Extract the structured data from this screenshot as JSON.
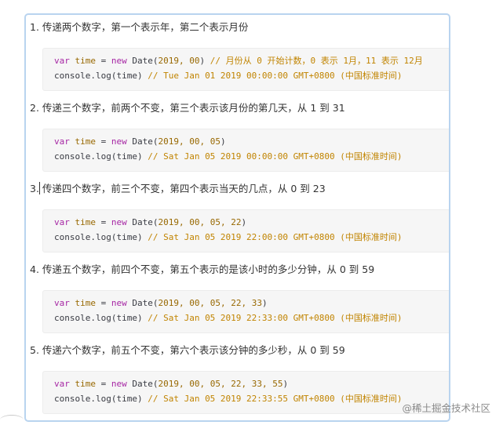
{
  "sections": [
    {
      "heading": "1. 传递两个数字，第一个表示年，第二个表示月份",
      "line1": {
        "kw": "var",
        "var": "time",
        "op": " = ",
        "new": "new",
        "call": " Date(",
        "args": "2019, 00",
        "close": ")",
        "comment": " // 月份从 0 开始计数，0 表示 1月，11 表示 12月"
      },
      "line2": {
        "code": "console.log(time)",
        "comment": " // Tue Jan 01 2019 00:00:00 GMT+0800 (中国标准时间)"
      }
    },
    {
      "heading": "2. 传递三个数字，前两个不变，第三个表示该月份的第几天，从 1 到 31",
      "line1": {
        "kw": "var",
        "var": "time",
        "op": " = ",
        "new": "new",
        "call": " Date(",
        "args": "2019, 00, 05",
        "close": ")",
        "comment": ""
      },
      "line2": {
        "code": "console.log(time)",
        "comment": " // Sat Jan 05 2019 00:00:00 GMT+0800 (中国标准时间)"
      }
    },
    {
      "heading": "3. 传递四个数字，前三个不变，第四个表示当天的几点，从 0 到 23",
      "line1": {
        "kw": "var",
        "var": "time",
        "op": " = ",
        "new": "new",
        "call": " Date(",
        "args": "2019, 00, 05, 22",
        "close": ")",
        "comment": ""
      },
      "line2": {
        "code": "console.log(time)",
        "comment": " // Sat Jan 05 2019 22:00:00 GMT+0800 (中国标准时间)"
      }
    },
    {
      "heading": "4. 传递五个数字，前四个不变，第五个表示的是该小时的多少分钟，从 0 到 59",
      "line1": {
        "kw": "var",
        "var": "time",
        "op": " = ",
        "new": "new",
        "call": " Date(",
        "args": "2019, 00, 05, 22, 33",
        "close": ")",
        "comment": ""
      },
      "line2": {
        "code": "console.log(time)",
        "comment": " // Sat Jan 05 2019 22:33:00 GMT+0800 (中国标准时间)"
      }
    },
    {
      "heading": "5. 传递六个数字，前五个不变，第六个表示该分钟的多少秒，从 0 到 59",
      "line1": {
        "kw": "var",
        "var": "time",
        "op": " = ",
        "new": "new",
        "call": " Date(",
        "args": "2019, 00, 05, 22, 33, 55",
        "close": ")",
        "comment": ""
      },
      "line2": {
        "code": "console.log(time)",
        "comment": " // Sat Jan 05 2019 22:33:55 GMT+0800 (中国标准时间)"
      }
    }
  ],
  "watermark": "@稀土掘金技术社区",
  "colors": {
    "keyword": "#a626a4",
    "variable": "#986801",
    "comment": "#c18401",
    "code_bg": "#f6f6f6",
    "frame_border": "#b9d4ef"
  }
}
